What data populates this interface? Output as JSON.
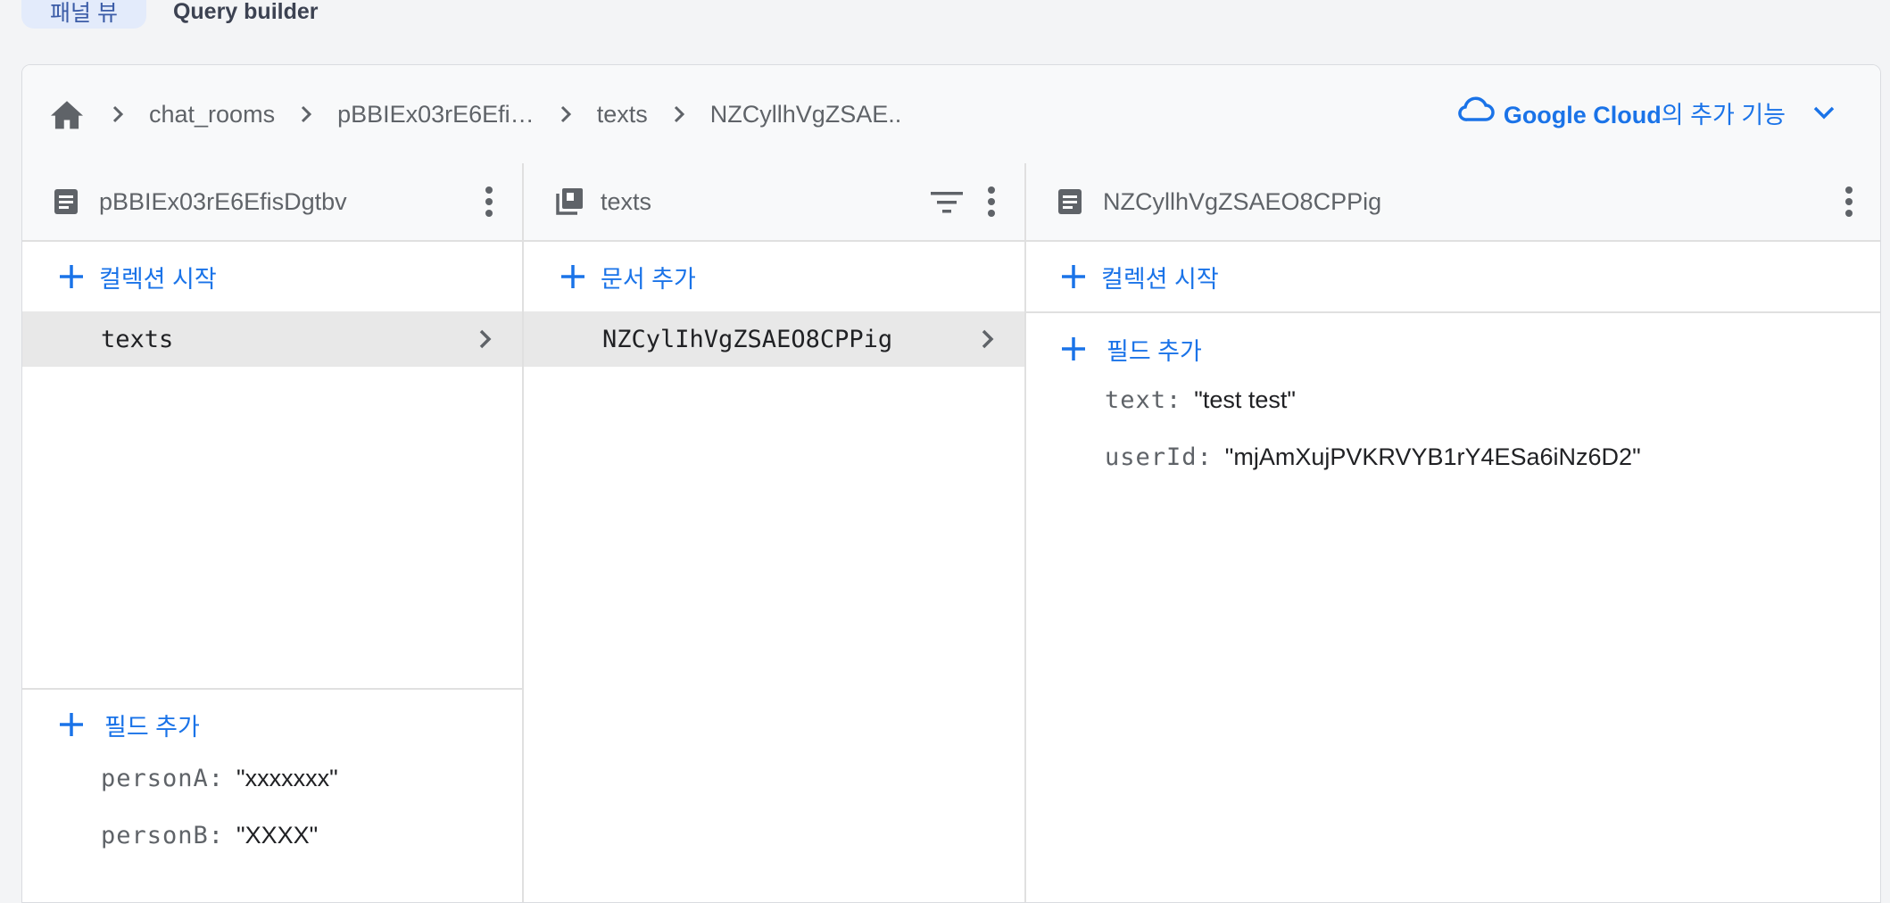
{
  "view_tabs": {
    "panel": "패널 뷰",
    "query": "Query builder"
  },
  "breadcrumb": [
    "chat_rooms",
    "pBBIEx03rE6Efi…",
    "texts",
    "NZCyllhVgZSAE.."
  ],
  "gcloud": {
    "brand": "Google Cloud",
    "rest": "의 추가 기능"
  },
  "col1": {
    "title": "pBBIEx03rE6EfisDgtbv",
    "start_collection": "컬렉션 시작",
    "items": [
      "texts"
    ],
    "add_field": "필드 추가",
    "fields": [
      {
        "key": "personA:",
        "value": "\"xxxxxxx\""
      },
      {
        "key": "personB:",
        "value": "\"XXXX\""
      }
    ]
  },
  "col2": {
    "title": "texts",
    "add_document": "문서 추가",
    "items": [
      "NZCylIhVgZSAEO8CPPig"
    ]
  },
  "col3": {
    "title": "NZCyllhVgZSAEO8CPPig",
    "start_collection": "컬렉션 시작",
    "add_field": "필드 추가",
    "fields": [
      {
        "key": "text:",
        "value": "\"test test\""
      },
      {
        "key": "userId:",
        "value": "\"mjAmXujPVKRVYB1rY4ESa6iNz6D2\""
      }
    ]
  },
  "colors": {
    "accent": "#1a73e8",
    "selected_row": "#e8e8e8",
    "header_bg": "#f8f9fa"
  }
}
